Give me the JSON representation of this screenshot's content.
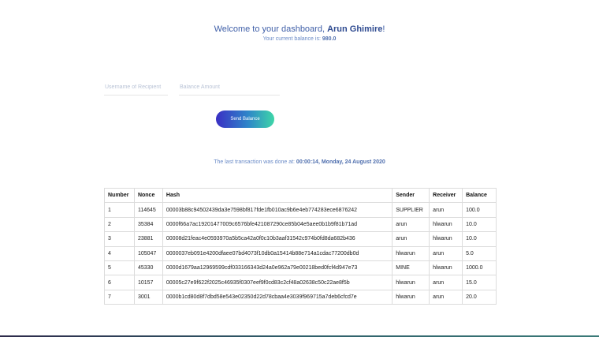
{
  "header": {
    "welcome_prefix": "Welcome to your dashboard, ",
    "user_name": "Arun Ghimire",
    "welcome_suffix": "!",
    "balance_label": "Your current balance is: ",
    "balance_value": "980.0"
  },
  "form": {
    "recipient_placeholder": "Username of Recipient",
    "recipient_value": "",
    "amount_placeholder": "Balance Amount",
    "amount_value": "",
    "send_label": "Send Balance"
  },
  "last_transaction": {
    "label": "The last transaction was done at: ",
    "value": "00:00:14, Monday, 24 August 2020"
  },
  "table": {
    "headers": [
      "Number",
      "Nonce",
      "Hash",
      "Sender",
      "Receiver",
      "Balance"
    ],
    "rows": [
      [
        "1",
        "114645",
        "00003b88c94502439da3e7598bf817fde1fb010ac9b6e4eb774283ece6876242",
        "SUPPLIER",
        "arun",
        "100.0"
      ],
      [
        "2",
        "35384",
        "0000f66a7ac19201477009c6576bfe421087290ce85b04e5aee0b1b9f81b71ad",
        "arun",
        "hlwarun",
        "10.0"
      ],
      [
        "3",
        "23881",
        "00008d21feac4e0593970a5b5ca42a0f0c10b3aaf31542c974b0fd8da682b436",
        "arun",
        "hlwarun",
        "10.0"
      ],
      [
        "4",
        "105047",
        "0000037eb091e4200dfaee07bd4073f10db0a15414b88e714a1cdac77200db0d",
        "hlwarun",
        "arun",
        "5.0"
      ],
      [
        "5",
        "45330",
        "0000d1679aa12969599cdf033166343d24a0e962a79e00218bed0fcf4d947e73",
        "MINE",
        "hlwarun",
        "1000.0"
      ],
      [
        "6",
        "10157",
        "00005c27e9f622f2025c46935f0307eef9f0cd83c2cf48a02638c50c22ae8f5b",
        "hlwarun",
        "arun",
        "15.0"
      ],
      [
        "7",
        "3001",
        "0000b1cd80d8f7dbd58e543e02350d22d78cbaa4e3039f969715a7deb6cfcd7e",
        "hlwarun",
        "arun",
        "20.0"
      ]
    ]
  }
}
